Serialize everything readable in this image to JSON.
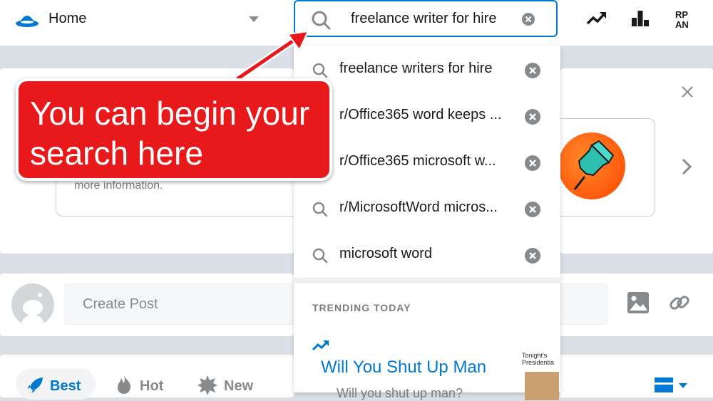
{
  "header": {
    "home_label": "Home",
    "search_value": "freelance writer for hire",
    "icons": [
      "reddit-home-icon",
      "caret-down-icon",
      "search-icon",
      "clear-icon",
      "trending-icon",
      "leaderboard-icon",
      "rpan-icon"
    ],
    "rpan_text": "RP\nAN"
  },
  "suggestions": [
    {
      "label": "freelance writers for hire"
    },
    {
      "label": "r/Office365 word keeps ..."
    },
    {
      "label": "r/Office365 microsoft w..."
    },
    {
      "label": "r/MicrosoftWord micros..."
    },
    {
      "label": "microsoft word"
    }
  ],
  "trending": {
    "section_label": "TRENDING TODAY",
    "title": "Will You Shut Up Man",
    "subtitle": "Will you shut up man?",
    "thumb_caption": "Tonight's Presidentia"
  },
  "promo": {
    "more_info": "more information."
  },
  "create_post": {
    "placeholder": "Create Post"
  },
  "sort": {
    "best": "Best",
    "hot": "Hot",
    "new": "New"
  },
  "callout": {
    "line1": "You can begin your",
    "line2": "search here"
  },
  "colors": {
    "accent": "#0079d3",
    "orange": "#ff4500",
    "callout_red": "#e8191a",
    "background": "#dae0e6"
  }
}
